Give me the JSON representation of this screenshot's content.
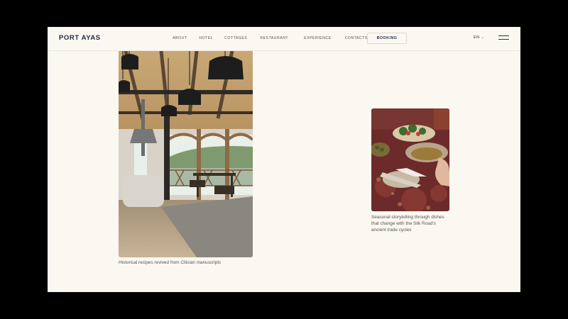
{
  "header": {
    "logo": "PORT AYAS",
    "nav": [
      "ABOUT",
      "HOTEL",
      "COTTAGES",
      "RESTAURANT",
      "EXPERIENCE",
      "CONTACTS"
    ],
    "booking_label": "BOOKING",
    "lang": "EN"
  },
  "gallery": {
    "caption_interior": "Historical recipes revived from Cilician manuscripts",
    "caption_food": "Seasonal storytelling through dishes that change with the Silk Road's ancient trade cycles"
  },
  "colors": {
    "background": "#fbf7f1",
    "brand": "#1f2a44"
  },
  "icons": [
    "chevron-down-icon",
    "hamburger-menu-icon"
  ]
}
